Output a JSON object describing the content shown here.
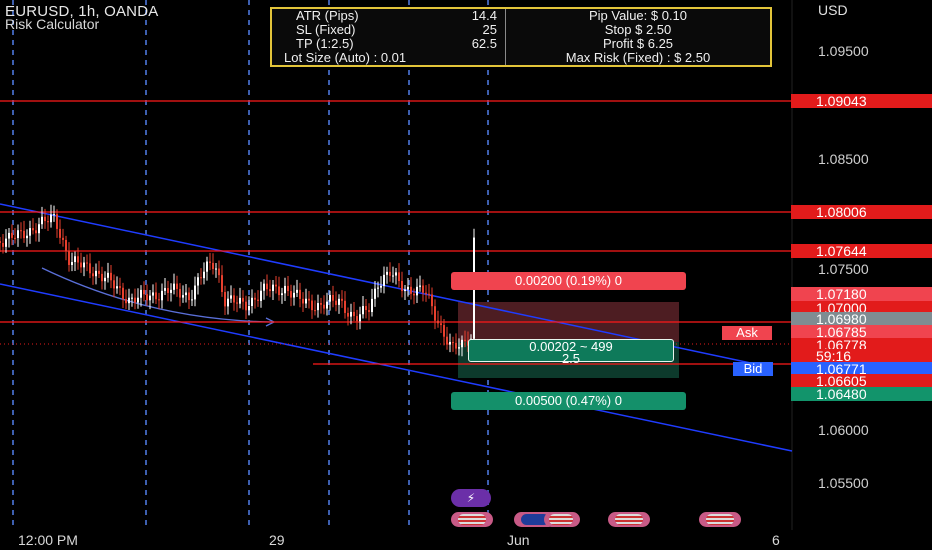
{
  "header": {
    "symbol": "EURUSD, 1h, OANDA",
    "indicator": "Risk Calculator"
  },
  "info_table": {
    "rows": [
      {
        "label": "ATR (Pips)",
        "value": "14.4",
        "right": "Pip Value: $ 0.10"
      },
      {
        "label": "SL (Fixed)",
        "value": "25",
        "right": "Stop $ 2.50"
      },
      {
        "label": "TP (1:2.5)",
        "value": "62.5",
        "right": "Profit $ 6.25"
      }
    ],
    "last_row": {
      "left": "Lot Size (Auto) : 0.01",
      "right": "Max Risk (Fixed) : $ 2.50"
    }
  },
  "price_axis": {
    "currency": "USD",
    "levels": [
      "1.09500",
      "1.08500",
      "1.07500",
      "1.06000",
      "1.05500"
    ],
    "labels": [
      {
        "text": "1.09043",
        "bg": "#e21b1b"
      },
      {
        "text": "1.08006",
        "bg": "#e21b1b"
      },
      {
        "text": "1.07644",
        "bg": "#e21b1b"
      },
      {
        "text": "1.07180",
        "bg": "#f0444f"
      },
      {
        "text": "1.07000",
        "bg": "#e21b1b"
      },
      {
        "text": "1.06980",
        "bg": "#7f8c92"
      },
      {
        "text": "1.06785",
        "bg": "#f0444f"
      },
      {
        "text": "1.06778",
        "bg": "#e21b1b"
      },
      {
        "text": "59:16",
        "bg": "#e21b1b"
      },
      {
        "text": "1.06771",
        "bg": "#2962ff"
      },
      {
        "text": "1.06605",
        "bg": "#e21b1b"
      },
      {
        "text": "1.06480",
        "bg": "#12946b"
      }
    ]
  },
  "time_axis": [
    "12:00 PM",
    "29",
    "Jun",
    "6"
  ],
  "position_tool": {
    "target_label": "0.00200 (0.19%) 0",
    "stop_label": "0.00500 (0.47%) 0",
    "center_line1": "0.00202 ~ 499",
    "center_line2": "2.5"
  },
  "ask_label": "Ask",
  "bid_label": "Bid",
  "colors": {
    "background": "#000000",
    "level_line": "#ff1a1a",
    "channel_line": "#1f3cff",
    "up_candle": "#ffffff",
    "down_candle": "#e8402e",
    "target_zone": "#4d1d22",
    "stop_zone": "#0d3a2c",
    "table_border": "#e3c53a"
  },
  "icons": [
    "lightning-icon",
    "us-flag-icon",
    "eu-flag-icon"
  ]
}
